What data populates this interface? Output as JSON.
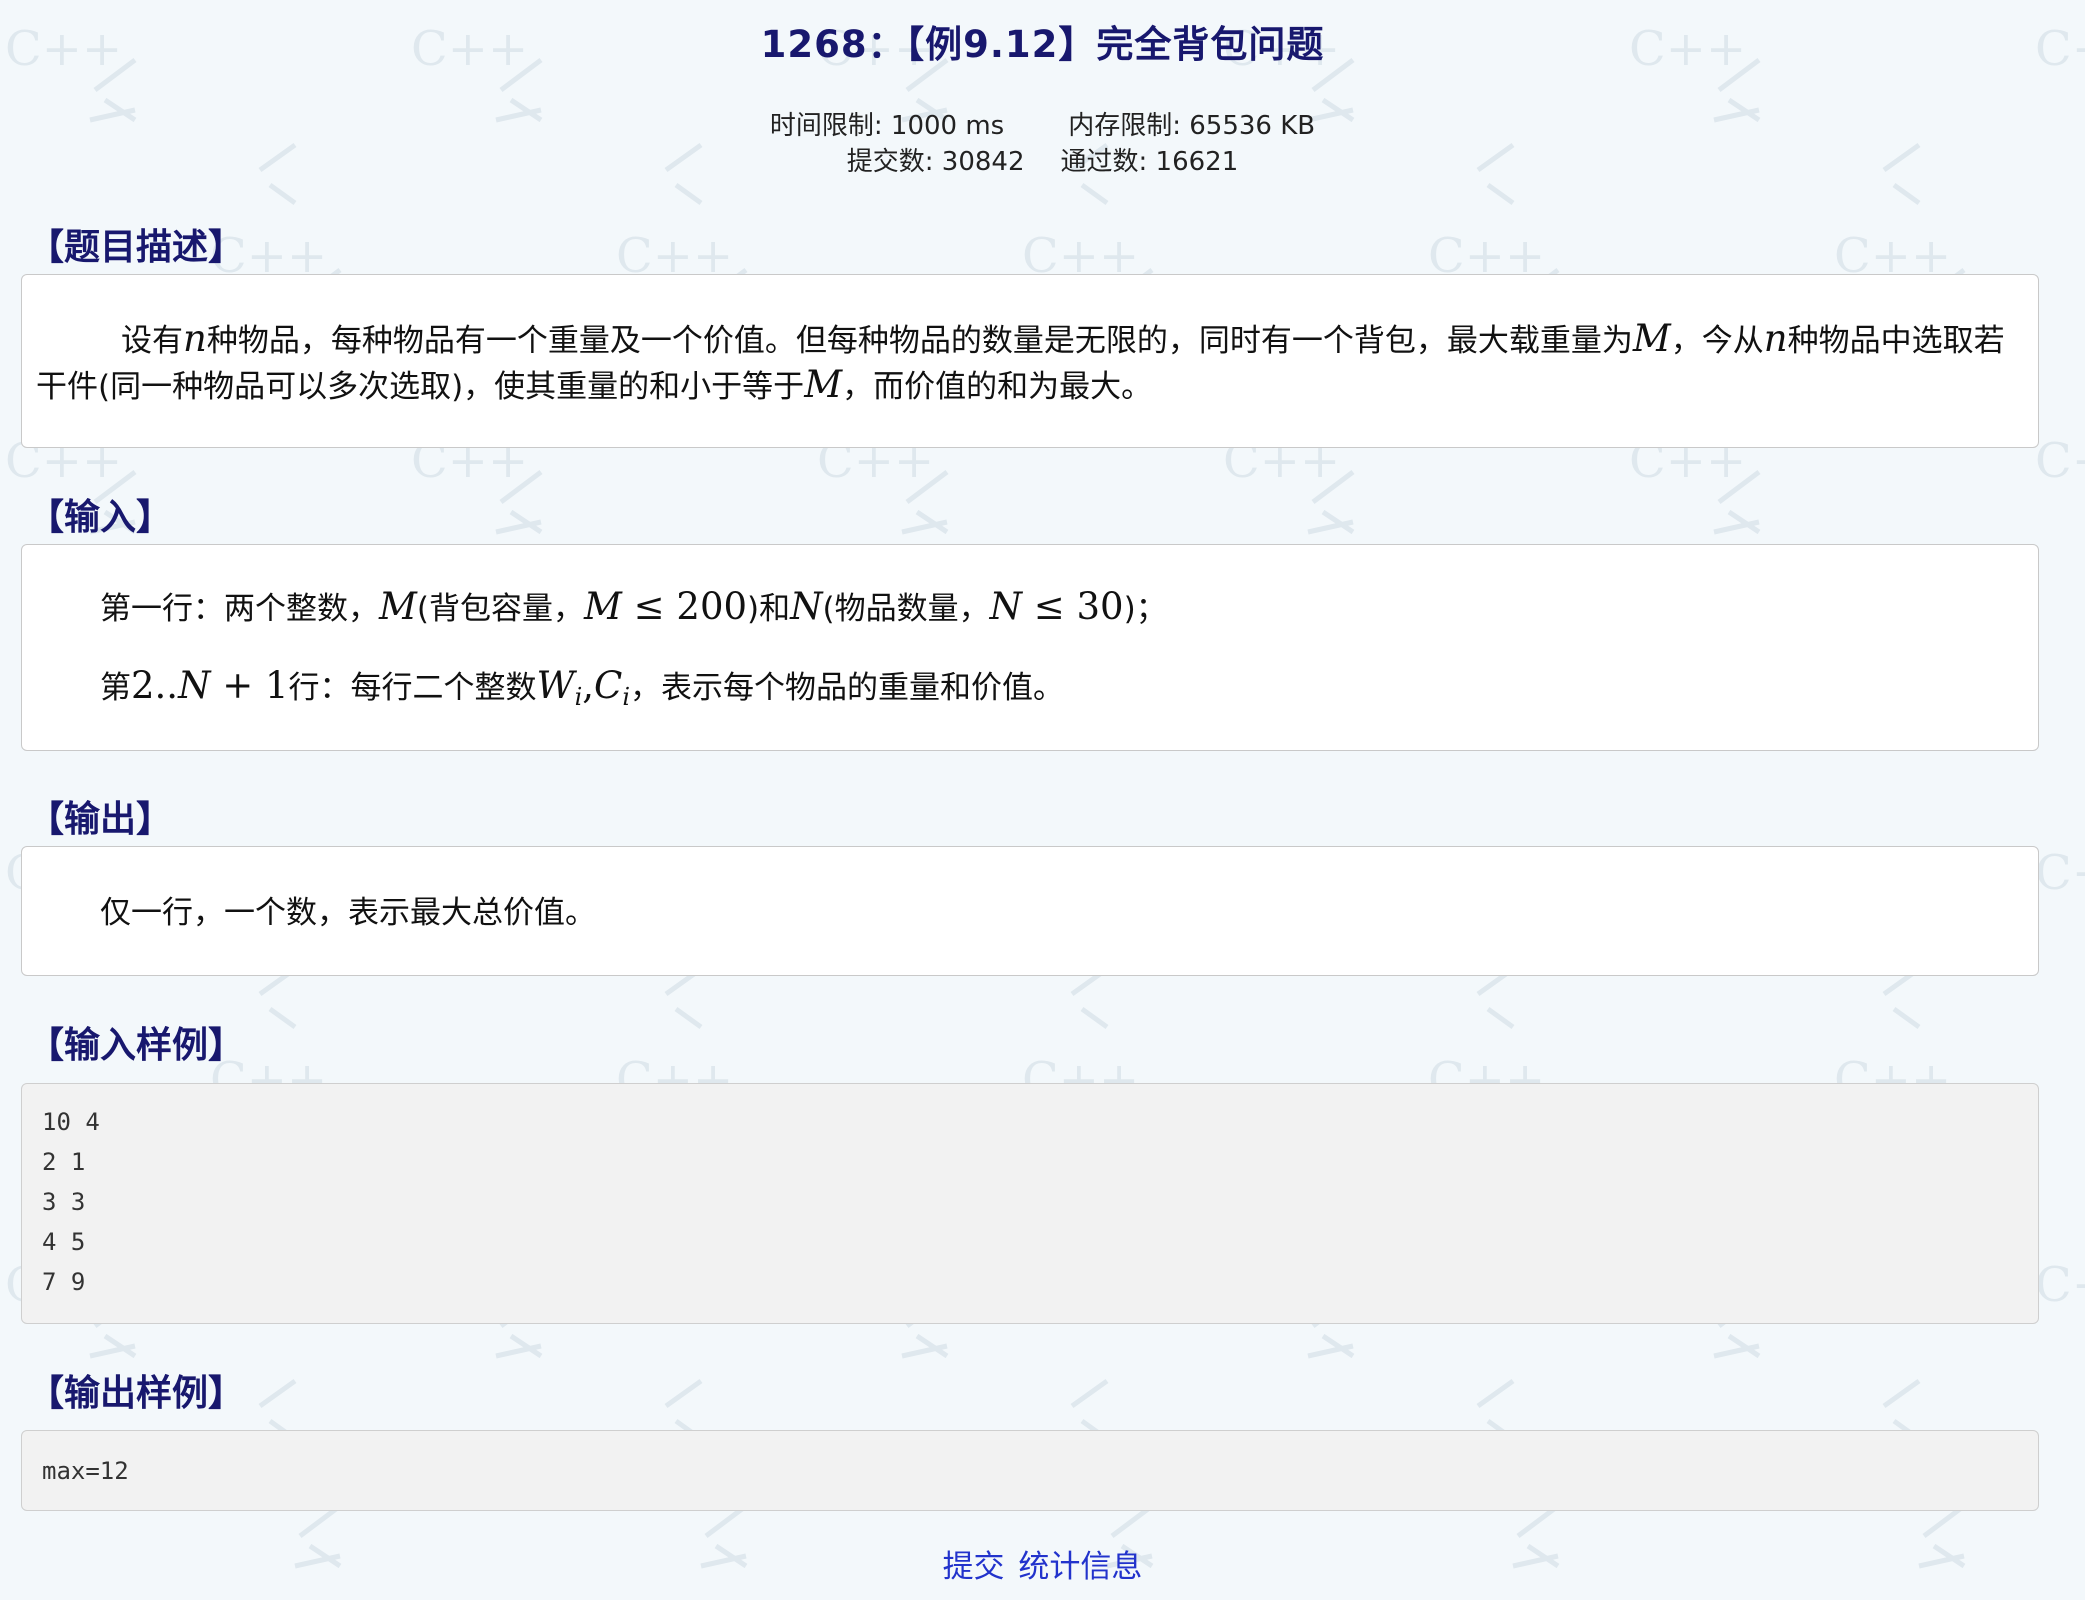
{
  "problem": {
    "title": "1268：【例9.12】完全背包问题",
    "time_limit": "时间限制: 1000 ms",
    "memory_limit": "内存限制: 65536 KB",
    "submissions": "提交数: 30842",
    "accepted": "通过数: 16621"
  },
  "description": {
    "heading": "【题目描述】",
    "t1": "设有",
    "n": "n",
    "t2": "种物品，每种物品有一个重量及一个价值。但每种物品的数量是无限的，同时有一个背包，最大载重量为",
    "M": "M",
    "t3": "，今从",
    "t4": "种物品中选取",
    "t5": "若干件(同一种物品可以多次选取)，使其重量的和小于等于",
    "t6": "，而价值的和为最大。"
  },
  "input": {
    "heading": "【输入】",
    "l1_a": "第一行：两个整数，",
    "M": "M",
    "l1_b": "(背包容量，",
    "le_200": " ≤ 200",
    "l1_c": ")和",
    "N": "N",
    "l1_d": "(物品数量，",
    "le_30": " ≤ 30",
    "l1_e": ")；",
    "l2_a": "第",
    "l2_range": "2..",
    "l2_plus": " + 1",
    "l2_b": "行：每行二个整数",
    "W": "W",
    "C": "C",
    "sub_i": "i",
    "comma": ",",
    "l2_c": "，表示每个物品的重量和价值。"
  },
  "output": {
    "heading": "【输出】",
    "text": "仅一行，一个数，表示最大总价值。"
  },
  "sample_input": {
    "heading": "【输入样例】",
    "code": "10 4\n2 1\n3 3\n4 5\n7 9"
  },
  "sample_output": {
    "heading": "【输出样例】",
    "code": "max=12"
  },
  "footer": {
    "submit_label": "提交",
    "stats_label": "统计信息"
  },
  "watermark": {
    "text": "C++"
  },
  "colors": {
    "heading": "#18186e",
    "link": "#2233cc",
    "background": "#f3f8fb"
  }
}
